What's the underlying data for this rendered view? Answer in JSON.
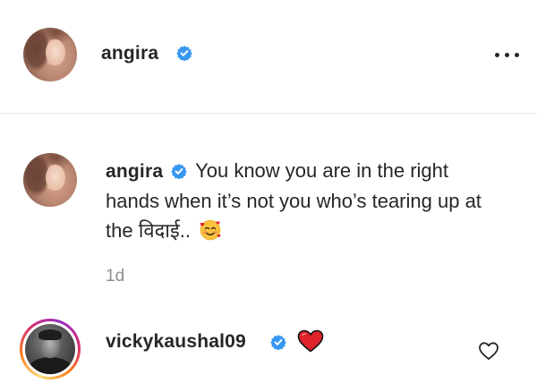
{
  "header": {
    "username": "angira",
    "avatar_icon": "profile-photo-angira",
    "verified_icon": "verified-badge-icon",
    "more_icon": "more-options-icon"
  },
  "caption": {
    "username": "angira",
    "text": "You know you are in the right hands when it’s not you who’s tearing up at the विदाई..",
    "emoji": "smiling-face-with-hearts-emoji",
    "timestamp": "1d"
  },
  "comment": {
    "username": "vickykaushal09",
    "avatar_icon": "profile-photo-vickykaushal09",
    "has_story_ring": true,
    "text_emoji": "red-heart-emoji",
    "like_icon": "heart-outline-icon"
  },
  "colors": {
    "text": "#262626",
    "muted": "#8e8e8e",
    "verified_blue": "#3897f0",
    "heart_red": "#e0232b",
    "divider": "#ebebeb"
  }
}
